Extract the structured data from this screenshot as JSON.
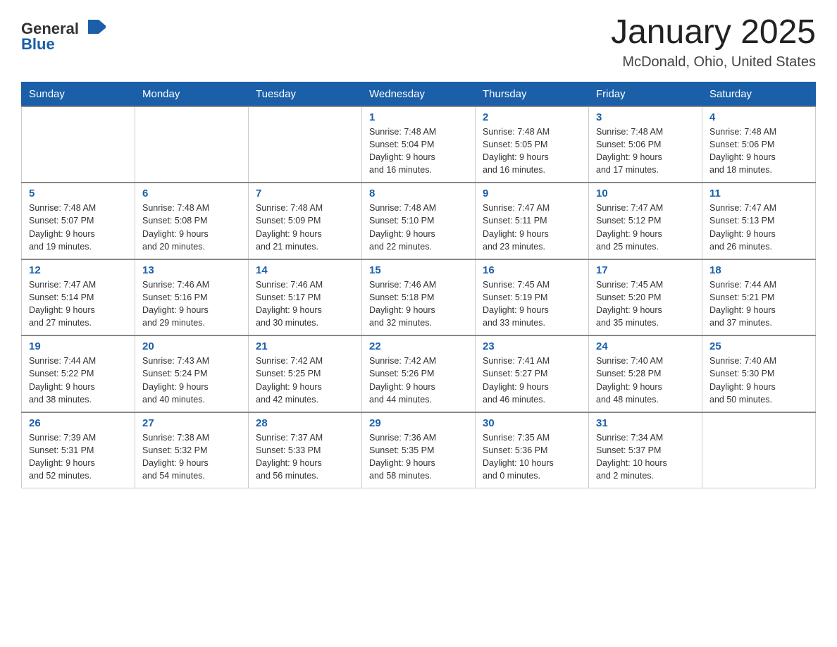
{
  "header": {
    "logo_general": "General",
    "logo_blue": "Blue",
    "title": "January 2025",
    "location": "McDonald, Ohio, United States"
  },
  "days_of_week": [
    "Sunday",
    "Monday",
    "Tuesday",
    "Wednesday",
    "Thursday",
    "Friday",
    "Saturday"
  ],
  "weeks": [
    [
      {
        "day": "",
        "info": ""
      },
      {
        "day": "",
        "info": ""
      },
      {
        "day": "",
        "info": ""
      },
      {
        "day": "1",
        "info": "Sunrise: 7:48 AM\nSunset: 5:04 PM\nDaylight: 9 hours\nand 16 minutes."
      },
      {
        "day": "2",
        "info": "Sunrise: 7:48 AM\nSunset: 5:05 PM\nDaylight: 9 hours\nand 16 minutes."
      },
      {
        "day": "3",
        "info": "Sunrise: 7:48 AM\nSunset: 5:06 PM\nDaylight: 9 hours\nand 17 minutes."
      },
      {
        "day": "4",
        "info": "Sunrise: 7:48 AM\nSunset: 5:06 PM\nDaylight: 9 hours\nand 18 minutes."
      }
    ],
    [
      {
        "day": "5",
        "info": "Sunrise: 7:48 AM\nSunset: 5:07 PM\nDaylight: 9 hours\nand 19 minutes."
      },
      {
        "day": "6",
        "info": "Sunrise: 7:48 AM\nSunset: 5:08 PM\nDaylight: 9 hours\nand 20 minutes."
      },
      {
        "day": "7",
        "info": "Sunrise: 7:48 AM\nSunset: 5:09 PM\nDaylight: 9 hours\nand 21 minutes."
      },
      {
        "day": "8",
        "info": "Sunrise: 7:48 AM\nSunset: 5:10 PM\nDaylight: 9 hours\nand 22 minutes."
      },
      {
        "day": "9",
        "info": "Sunrise: 7:47 AM\nSunset: 5:11 PM\nDaylight: 9 hours\nand 23 minutes."
      },
      {
        "day": "10",
        "info": "Sunrise: 7:47 AM\nSunset: 5:12 PM\nDaylight: 9 hours\nand 25 minutes."
      },
      {
        "day": "11",
        "info": "Sunrise: 7:47 AM\nSunset: 5:13 PM\nDaylight: 9 hours\nand 26 minutes."
      }
    ],
    [
      {
        "day": "12",
        "info": "Sunrise: 7:47 AM\nSunset: 5:14 PM\nDaylight: 9 hours\nand 27 minutes."
      },
      {
        "day": "13",
        "info": "Sunrise: 7:46 AM\nSunset: 5:16 PM\nDaylight: 9 hours\nand 29 minutes."
      },
      {
        "day": "14",
        "info": "Sunrise: 7:46 AM\nSunset: 5:17 PM\nDaylight: 9 hours\nand 30 minutes."
      },
      {
        "day": "15",
        "info": "Sunrise: 7:46 AM\nSunset: 5:18 PM\nDaylight: 9 hours\nand 32 minutes."
      },
      {
        "day": "16",
        "info": "Sunrise: 7:45 AM\nSunset: 5:19 PM\nDaylight: 9 hours\nand 33 minutes."
      },
      {
        "day": "17",
        "info": "Sunrise: 7:45 AM\nSunset: 5:20 PM\nDaylight: 9 hours\nand 35 minutes."
      },
      {
        "day": "18",
        "info": "Sunrise: 7:44 AM\nSunset: 5:21 PM\nDaylight: 9 hours\nand 37 minutes."
      }
    ],
    [
      {
        "day": "19",
        "info": "Sunrise: 7:44 AM\nSunset: 5:22 PM\nDaylight: 9 hours\nand 38 minutes."
      },
      {
        "day": "20",
        "info": "Sunrise: 7:43 AM\nSunset: 5:24 PM\nDaylight: 9 hours\nand 40 minutes."
      },
      {
        "day": "21",
        "info": "Sunrise: 7:42 AM\nSunset: 5:25 PM\nDaylight: 9 hours\nand 42 minutes."
      },
      {
        "day": "22",
        "info": "Sunrise: 7:42 AM\nSunset: 5:26 PM\nDaylight: 9 hours\nand 44 minutes."
      },
      {
        "day": "23",
        "info": "Sunrise: 7:41 AM\nSunset: 5:27 PM\nDaylight: 9 hours\nand 46 minutes."
      },
      {
        "day": "24",
        "info": "Sunrise: 7:40 AM\nSunset: 5:28 PM\nDaylight: 9 hours\nand 48 minutes."
      },
      {
        "day": "25",
        "info": "Sunrise: 7:40 AM\nSunset: 5:30 PM\nDaylight: 9 hours\nand 50 minutes."
      }
    ],
    [
      {
        "day": "26",
        "info": "Sunrise: 7:39 AM\nSunset: 5:31 PM\nDaylight: 9 hours\nand 52 minutes."
      },
      {
        "day": "27",
        "info": "Sunrise: 7:38 AM\nSunset: 5:32 PM\nDaylight: 9 hours\nand 54 minutes."
      },
      {
        "day": "28",
        "info": "Sunrise: 7:37 AM\nSunset: 5:33 PM\nDaylight: 9 hours\nand 56 minutes."
      },
      {
        "day": "29",
        "info": "Sunrise: 7:36 AM\nSunset: 5:35 PM\nDaylight: 9 hours\nand 58 minutes."
      },
      {
        "day": "30",
        "info": "Sunrise: 7:35 AM\nSunset: 5:36 PM\nDaylight: 10 hours\nand 0 minutes."
      },
      {
        "day": "31",
        "info": "Sunrise: 7:34 AM\nSunset: 5:37 PM\nDaylight: 10 hours\nand 2 minutes."
      },
      {
        "day": "",
        "info": ""
      }
    ]
  ]
}
